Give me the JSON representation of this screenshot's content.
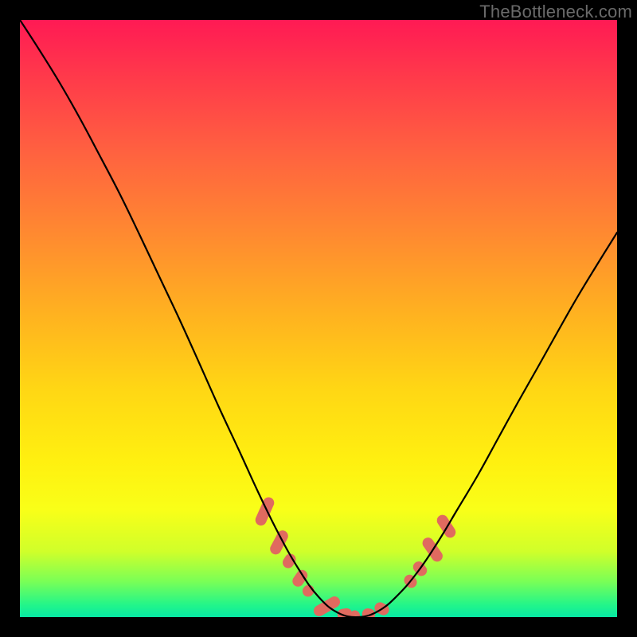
{
  "watermark": "TheBottleneck.com",
  "chart_data": {
    "type": "line",
    "title": "",
    "xlabel": "",
    "ylabel": "",
    "xlim": [
      0,
      100
    ],
    "ylim": [
      0,
      100
    ],
    "series": [
      {
        "name": "bottleneck-curve",
        "x": [
          0,
          3.3,
          6.7,
          10,
          13.3,
          16.7,
          20,
          23.3,
          26.7,
          30,
          33.3,
          36.7,
          40,
          43.3,
          46.7,
          50,
          53.3,
          56.7,
          60,
          63.3,
          66.7,
          70,
          73.3,
          76.7,
          80,
          83.3,
          86.7,
          90,
          93.3,
          96.7,
          100
        ],
        "y": [
          100,
          94.9,
          89.4,
          83.6,
          77.4,
          70.9,
          64.1,
          57.1,
          49.9,
          42.6,
          35.2,
          27.9,
          20.7,
          14,
          8,
          3.4,
          0.7,
          0,
          1,
          3.7,
          7.7,
          12.6,
          18.1,
          23.8,
          29.8,
          35.8,
          41.8,
          47.7,
          53.5,
          59.1,
          64.4
        ]
      }
    ],
    "highlight_segments": [
      {
        "cx": 41.0,
        "cy": 17.7,
        "len": 5.0,
        "angle": 66
      },
      {
        "cx": 43.4,
        "cy": 12.5,
        "len": 4.3,
        "angle": 62
      },
      {
        "cx": 45.1,
        "cy": 9.4,
        "len": 2.5,
        "angle": 58
      },
      {
        "cx": 46.9,
        "cy": 6.5,
        "len": 3.0,
        "angle": 55
      },
      {
        "cx": 48.3,
        "cy": 4.4,
        "len": 2.0,
        "angle": 50
      },
      {
        "cx": 51.4,
        "cy": 1.8,
        "len": 4.8,
        "angle": 30
      },
      {
        "cx": 54.4,
        "cy": 0.5,
        "len": 2.5,
        "angle": 10
      },
      {
        "cx": 56.1,
        "cy": 0.2,
        "len": 1.7,
        "angle": 2
      },
      {
        "cx": 58.4,
        "cy": 0.5,
        "len": 2.2,
        "angle": -10
      },
      {
        "cx": 60.6,
        "cy": 1.4,
        "len": 2.5,
        "angle": -28
      },
      {
        "cx": 65.4,
        "cy": 6.0,
        "len": 2.3,
        "angle": -50
      },
      {
        "cx": 67.0,
        "cy": 8.1,
        "len": 2.6,
        "angle": -52
      },
      {
        "cx": 69.1,
        "cy": 11.3,
        "len": 4.5,
        "angle": -55
      },
      {
        "cx": 71.4,
        "cy": 15.2,
        "len": 4.2,
        "angle": -57
      }
    ],
    "highlight_color": "#e06a5f"
  }
}
